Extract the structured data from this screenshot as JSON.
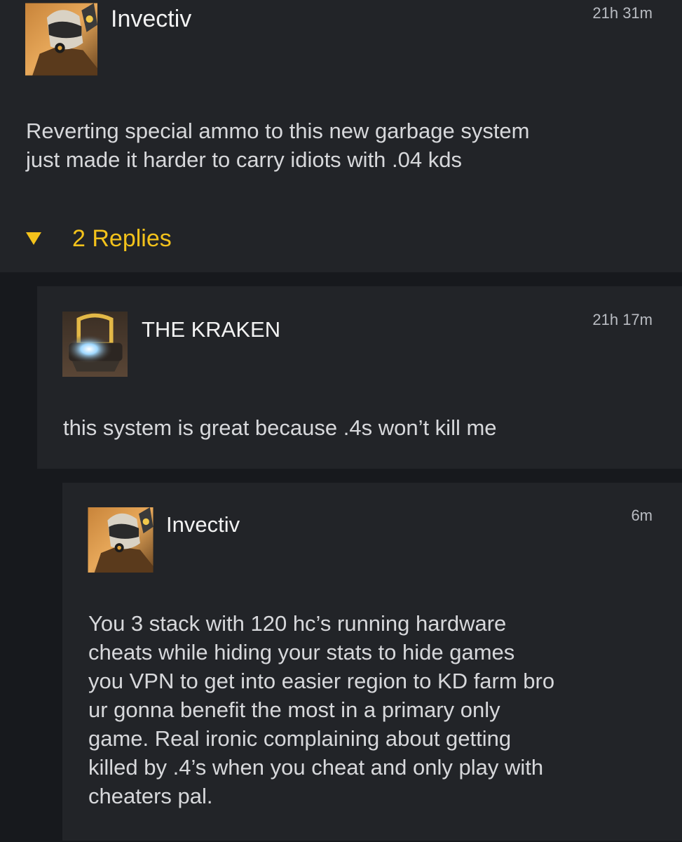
{
  "comments": [
    {
      "username": "Invectiv",
      "timestamp": "21h 31m",
      "avatar": "helmeted-warrior-avatar",
      "body_lines": [
        "Reverting special ammo to this new garbage system",
        "just made it harder to carry idiots with .04 kds"
      ],
      "replies_label": "2 Replies"
    },
    {
      "username": "THE KRAKEN",
      "timestamp": "21h 17m",
      "avatar": "glowing-chest-avatar",
      "body_lines": [
        "this system is great because .4s won’t kill me"
      ]
    },
    {
      "username": "Invectiv",
      "timestamp": "6m",
      "avatar": "helmeted-warrior-avatar",
      "body_lines": [
        "You 3 stack with 120 hc’s running hardware",
        "cheats while hiding your stats to hide games",
        "you VPN to get into easier region to KD farm bro",
        "ur gonna benefit the most in a primary only",
        "game. Real ironic complaining about getting",
        "killed by .4’s when you cheat and only play with",
        "cheaters pal."
      ]
    }
  ],
  "colors": {
    "background": "#17191d",
    "card": "#222428",
    "accent": "#f3c21b",
    "text": "#d7d8db",
    "muted": "#b9bcc2"
  },
  "icons": {
    "toggle": "triangle-down-icon"
  }
}
